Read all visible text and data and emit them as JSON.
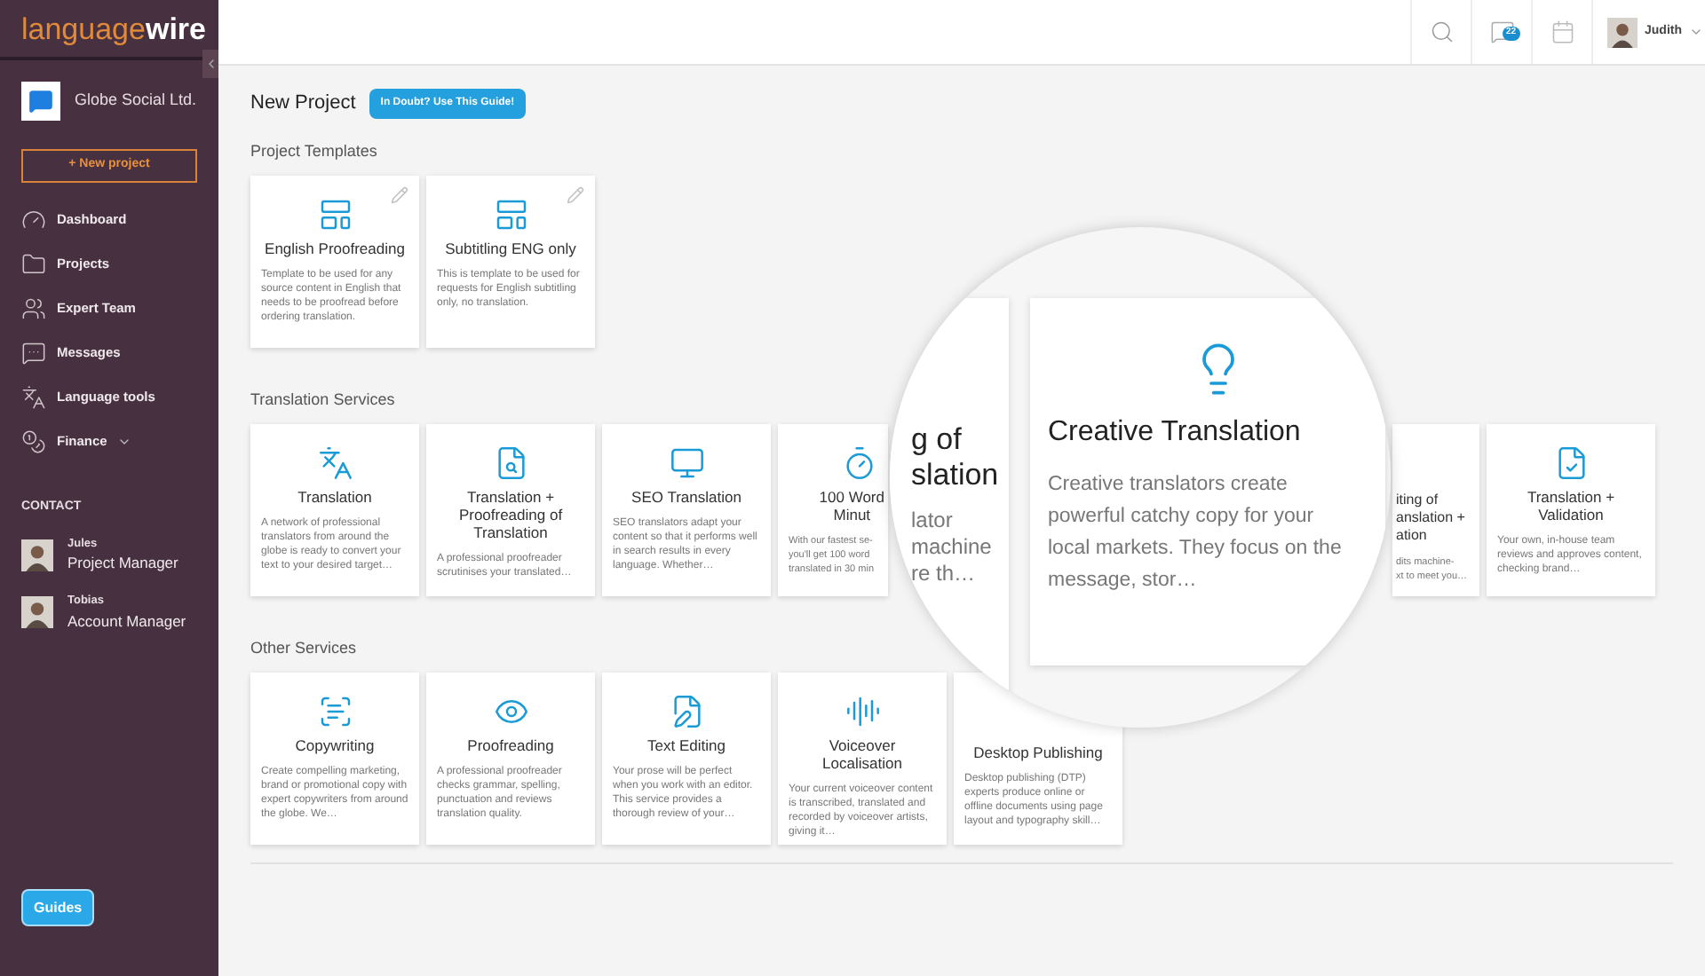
{
  "sidebar": {
    "logo_light": "language",
    "logo_bold": "wire",
    "company": "Globe Social Ltd.",
    "new_project_button": "+ New project",
    "nav": [
      {
        "label": "Dashboard",
        "dropdown": false
      },
      {
        "label": "Projects",
        "dropdown": false
      },
      {
        "label": "Expert Team",
        "dropdown": false
      },
      {
        "label": "Messages",
        "dropdown": false
      },
      {
        "label": "Language tools",
        "dropdown": false
      },
      {
        "label": "Finance",
        "dropdown": true
      }
    ],
    "contact_heading": "CONTACT",
    "contacts": [
      {
        "name": "Jules",
        "role": "Project Manager"
      },
      {
        "name": "Tobias",
        "role": "Account Manager"
      }
    ],
    "guides_button": "Guides"
  },
  "header": {
    "messages_count": "22",
    "user": "Judith"
  },
  "main": {
    "title": "New Project",
    "guide_button": "In Doubt? Use This Guide!",
    "sections": [
      {
        "title": "Project Templates",
        "cards": [
          {
            "kind": "full",
            "editable": true,
            "title": "English Proofreading",
            "description": "Template to be used for any source content in English that needs to be proofread before ordering translation."
          },
          {
            "kind": "full",
            "editable": true,
            "title": "Subtitling ENG only",
            "description": "This is template to be used for requests for English subtitling only, no translation."
          }
        ]
      },
      {
        "title": "Translation Services",
        "cards": [
          {
            "kind": "full",
            "editable": false,
            "title": "Translation",
            "description": "A network of professional translators from around the globe is ready to convert your text to your desired target…"
          },
          {
            "kind": "full",
            "editable": false,
            "title": "Translation + Proofreading of Translation",
            "description": "A professional proofreader scrutinises your translated…"
          },
          {
            "kind": "full",
            "editable": false,
            "title": "SEO Translation",
            "description": "SEO translators adapt your content so that it performs well in search results in every language. Whether…"
          },
          {
            "kind": "partial_right",
            "editable": false,
            "title": "100 Word\nMinut",
            "description": "With our fastest se-\nyou'll get 100 word\ntranslated in 30 min"
          },
          {
            "kind": "partial_left",
            "editable": false,
            "title": "iting of\nanslation +\nation",
            "description": "dits machine-\nxt to meet you…"
          },
          {
            "kind": "full",
            "editable": false,
            "title": "Translation + Validation",
            "description": "Your own, in-house team reviews and approves content, checking brand…"
          }
        ]
      },
      {
        "title": "Other Services",
        "cards": [
          {
            "kind": "full",
            "editable": false,
            "title": "Copywriting",
            "description": "Create compelling marketing, brand or promotional copy with expert copywriters from around the globe. We…"
          },
          {
            "kind": "full",
            "editable": false,
            "title": "Proofreading",
            "description": "A professional proofreader checks grammar, spelling, punctuation and reviews translation quality."
          },
          {
            "kind": "full",
            "editable": false,
            "title": "Text Editing",
            "description": "Your prose will be perfect when you work with an editor. This service provides a thorough review of your…"
          },
          {
            "kind": "full",
            "editable": false,
            "title": "Voiceover Localisation",
            "description": "Your current voiceover content is transcribed, translated and recorded by voiceover artists, giving it…"
          },
          {
            "kind": "partial_top",
            "editable": false,
            "title": "Desktop Publishing",
            "description": "Desktop publishing (DTP) experts produce online or offline documents using page layout and typography skill…"
          }
        ]
      }
    ]
  },
  "magnifier": {
    "fragment_title": "g of\nslation",
    "fragment_description": "lator\nmachine\nre th…",
    "card": {
      "title": "Creative Translation",
      "description": "Creative translators create powerful catchy copy for your local markets. They focus on the message, stor…"
    }
  }
}
